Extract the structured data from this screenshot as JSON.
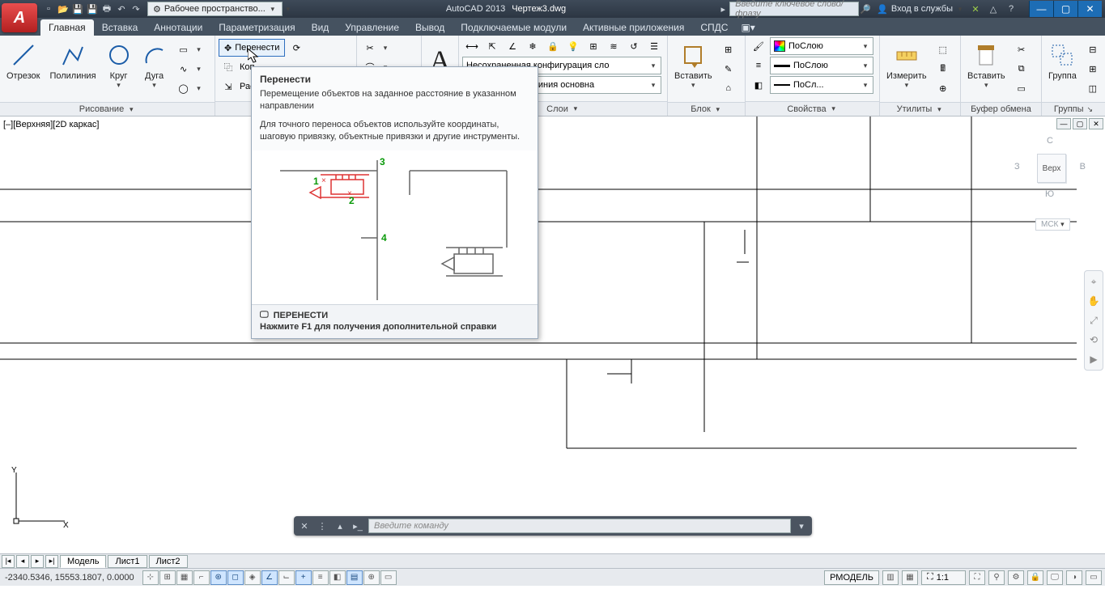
{
  "title": {
    "app": "AutoCAD 2013",
    "doc": "Чертеж3.dwg"
  },
  "qat_workspace": "Рабочее пространство...",
  "search_placeholder": "Введите ключевое слово/фразу",
  "signin": "Вход в службы",
  "tabs": {
    "home": "Главная",
    "insert": "Вставка",
    "annotate": "Аннотации",
    "param": "Параметризация",
    "view": "Вид",
    "manage": "Управление",
    "output": "Вывод",
    "plugins": "Подключаемые модули",
    "active": "Активные приложения",
    "spds": "СПДС"
  },
  "draw": {
    "title": "Рисование",
    "line": "Отрезок",
    "pline": "Полилиния",
    "circle": "Круг",
    "arc": "Дуга"
  },
  "modify": {
    "move": "Перенести",
    "copy": "Коп",
    "copy_full": "Копировать",
    "stretch": "Рас",
    "stretch_full": "Растянуть"
  },
  "layers": {
    "title": "Слои",
    "unsaved": "Несохраненная конфигурация сло",
    "line": "Линия основна"
  },
  "block": {
    "title": "Блок",
    "insert": "Вставить"
  },
  "props": {
    "title": "Свойства",
    "bylayer": "ПоСлою",
    "bylayer2": "ПоСлою",
    "byla": "ПоСл..."
  },
  "utils": {
    "title": "Утилиты",
    "measure": "Измерить"
  },
  "clip": {
    "title": "Буфер обмена",
    "paste": "Вставить"
  },
  "groups": {
    "title": "Группы",
    "group": "Группа"
  },
  "viewport_label": "[–][Верхняя][2D каркас]",
  "viewcube": {
    "top": "С",
    "left": "З",
    "right": "В",
    "bottom": "Ю",
    "face": "Верх",
    "wcs": "МСК"
  },
  "tooltip": {
    "title": "Перенести",
    "desc1": "Перемещение объектов на заданное расстояние в указанном направлении",
    "desc2": "Для точного переноса объектов используйте координаты, шаговую привязку, объектные привязки и другие инструменты.",
    "cmd": "ПЕРЕНЕСТИ",
    "f1": "Нажмите F1 для получения дополнительной справки",
    "nums": [
      "1",
      "2",
      "3",
      "4"
    ]
  },
  "layout": {
    "model": "Модель",
    "sheet1": "Лист1",
    "sheet2": "Лист2"
  },
  "cmd_placeholder": "Введите команду",
  "status": {
    "coords": "-2340.5346, 15553.1807, 0.0000",
    "space": "РМОДЕЛЬ",
    "scale": "1:1"
  }
}
